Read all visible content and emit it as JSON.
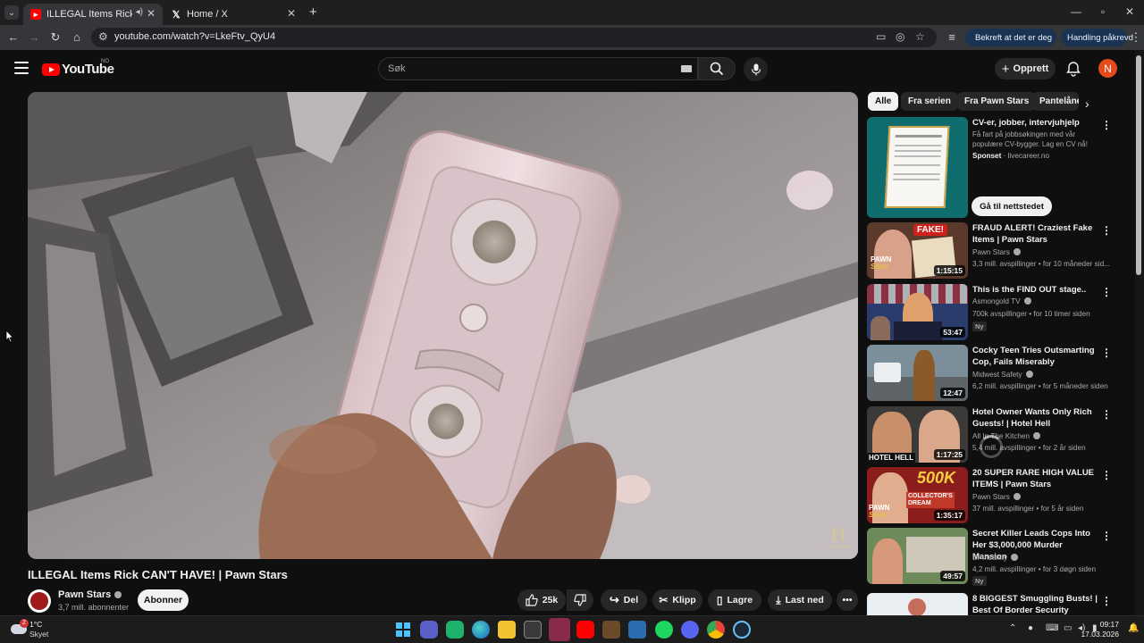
{
  "browser": {
    "tabs": [
      {
        "title": "ILLEGAL Items Rick CAN'T H",
        "active": true,
        "favicon": "youtube-icon",
        "audio": true
      },
      {
        "title": "Home / X",
        "active": false,
        "favicon": "x-icon"
      }
    ],
    "new_tab_symbol": "+",
    "url": "youtube.com/watch?v=LkeFtv_QyU4",
    "confirm_pill": "Bekreft at det er deg",
    "action_pill": "Handling påkrevd"
  },
  "youtube": {
    "logo_text": "YouTube",
    "region": "NO",
    "search_placeholder": "Søk",
    "create_label": "Opprett",
    "avatar_letter": "N"
  },
  "video": {
    "title": "ILLEGAL Items Rick CAN'T HAVE! | Pawn Stars",
    "channel": "Pawn Stars",
    "subscribers": "3,7 mill. abonnenter",
    "subscribe_label": "Abonner",
    "likes": "25k",
    "share_label": "Del",
    "clip_label": "Klipp",
    "save_label": "Lagre",
    "download_label": "Last ned",
    "watermark": "H",
    "watermark_small": "HISTORY"
  },
  "chips": [
    "Alle",
    "Fra serien",
    "Fra Pawn Stars",
    "Pantelåne"
  ],
  "ad": {
    "title": "CV-er, jobber, intervjuhjelp",
    "desc": "Få fart på jobbsøkingen med vår populære CV-bygger. Lag en CV nå!",
    "sponsored": "Sponset",
    "domain": "livecareer.no",
    "cta": "Gå til nettstedet"
  },
  "recommendations": [
    {
      "title": "FRAUD ALERT! Craziest Fake Items | Pawn Stars",
      "channel": "Pawn Stars",
      "meta": "3,3 mill. avspillinger • for 10 måneder sid...",
      "duration": "1:15:15",
      "badge": ""
    },
    {
      "title": "This is the FIND OUT stage..",
      "channel": "Asmongold TV",
      "meta": "700k avspillinger • for 10 timer siden",
      "duration": "53:47",
      "badge": "Ny"
    },
    {
      "title": "Cocky Teen Tries Outsmarting Cop, Fails Miserably",
      "channel": "Midwest Safety",
      "meta": "6,2 mill. avspillinger • for 5 måneder siden",
      "duration": "12:47",
      "badge": ""
    },
    {
      "title": "Hotel Owner Wants Only Rich Guests! | Hotel Hell",
      "channel": "All In The Kitchen",
      "meta": "5,4 mill. avspillinger • for 2 år siden",
      "duration": "1:17:25",
      "badge": ""
    },
    {
      "title": "20 SUPER RARE HIGH VALUE ITEMS | Pawn Stars",
      "channel": "Pawn Stars",
      "meta": "37 mill. avspillinger • for 5 år siden",
      "duration": "1:35:17",
      "badge": ""
    },
    {
      "title": "Secret Killer Leads Cops Into Her $3,000,000 Murder Mansion",
      "channel": "Dr Insanity",
      "meta": "4,2 mill. avspillinger • for 3 døgn siden",
      "duration": "49:57",
      "badge": "Ny"
    },
    {
      "title": "8 BIGGEST Smuggling Busts! | Best Of Border Security",
      "channel": "",
      "meta": "",
      "duration": "",
      "badge": ""
    }
  ],
  "thumb_texts": {
    "fake": "FAKE!",
    "pawn": "PAWN",
    "stars": "Stars",
    "hotel_hell": "HOTEL HELL",
    "k500": "500K",
    "collectors": "COLLECTOR'S",
    "dream": "DREAM"
  },
  "taskbar": {
    "temp": "1°C",
    "weather": "Skyet",
    "time": "09:17",
    "date": "17.03.2026",
    "notif_count": "2"
  },
  "colors": {
    "yt_red": "#ff0000",
    "background": "#0f0f0f",
    "chip_bg": "#272727"
  }
}
